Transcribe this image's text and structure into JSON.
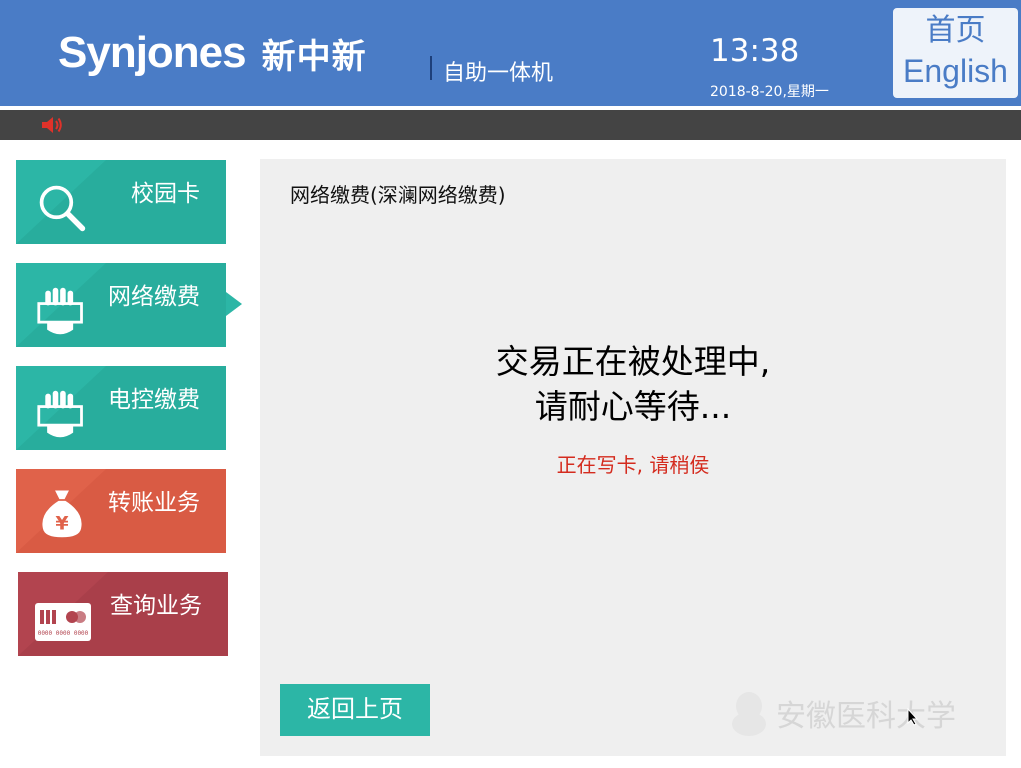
{
  "header": {
    "brand": "Synjones",
    "brand_cn": "新中新",
    "subtitle": "自助一体机",
    "time": "13:38",
    "date": "2018-8-20,星期一",
    "home_label": "首页",
    "english_label": "English"
  },
  "menu": {
    "items": [
      {
        "label": "校园卡",
        "icon": "search-icon",
        "color": "#2cb6a6"
      },
      {
        "label": "网络缴费",
        "icon": "hand-card-icon",
        "color": "#2cb6a6",
        "selected": true
      },
      {
        "label": "电控缴费",
        "icon": "hand-card-icon",
        "color": "#2cb6a6"
      },
      {
        "label": "转账业务",
        "icon": "money-bag-icon",
        "color": "#e0624a"
      },
      {
        "label": "查询业务",
        "icon": "bank-card-icon",
        "color": "#b2444f"
      }
    ],
    "card_number_text": "0000 0000 0000"
  },
  "panel": {
    "title": "网络缴费(深澜网络缴费)",
    "processing_line1": "交易正在被处理中,",
    "processing_line2": "请耐心等待...",
    "status": "正在写卡, 请稍侯",
    "back_label": "返回上页"
  },
  "watermark": {
    "text": "安徽医科大学"
  },
  "colors": {
    "header": "#4a7cc6",
    "teal": "#2cb6a6",
    "orange": "#e0624a",
    "crimson": "#b2444f",
    "status_red": "#d42b1e"
  }
}
